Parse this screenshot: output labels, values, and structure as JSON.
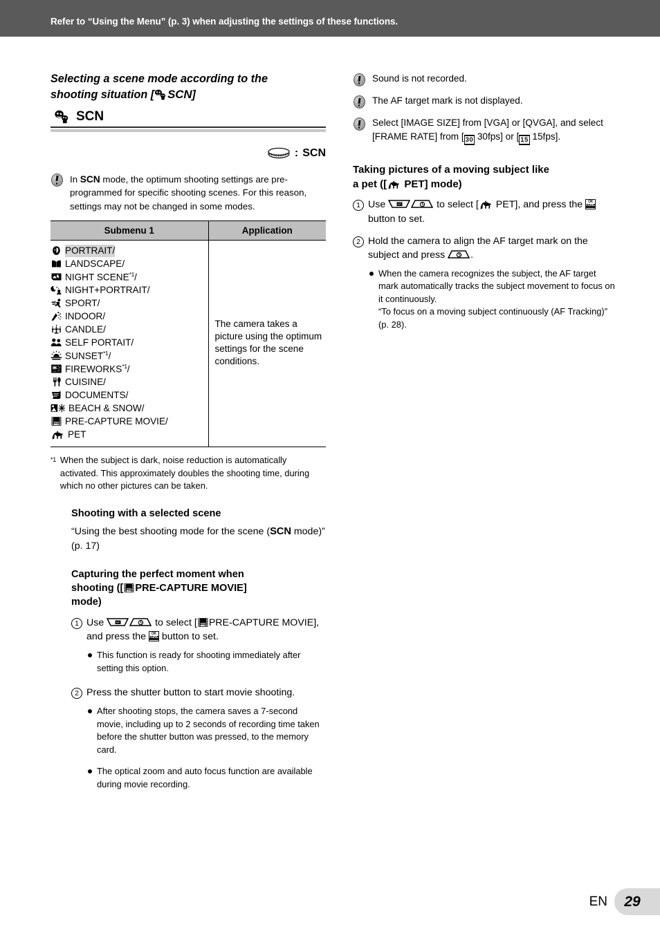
{
  "banner": {
    "text": "Refer to “Using the Menu” (p. 3) when adjusting the settings of these functions."
  },
  "left": {
    "section_title_line1": "Selecting a scene mode according to the",
    "section_title_line2_pre": "shooting situation [",
    "section_title_scn": "SCN",
    "section_title_line2_post": "]",
    "mode_label": "SCN",
    "dial_separator": ":",
    "dial_mode": "SCN",
    "intro_note": {
      "pre": "In ",
      "scn": "SCN",
      "post": " mode, the optimum shooting settings are pre-programmed for specific shooting scenes. For this reason, settings may not be changed in some modes."
    },
    "table": {
      "headers": [
        "Submenu 1",
        "Application"
      ],
      "application_text": "The camera takes a picture using the optimum settings for the scene conditions.",
      "rows": [
        {
          "icon": "portrait-icon",
          "label": "PORTRAIT/",
          "highlight": true,
          "footnote": ""
        },
        {
          "icon": "landscape-icon",
          "label": "LANDSCAPE/",
          "highlight": false,
          "footnote": ""
        },
        {
          "icon": "night-scene-icon",
          "label": "NIGHT SCENE",
          "highlight": false,
          "footnote": "*1",
          "suffix": "/"
        },
        {
          "icon": "night-portrait-icon",
          "label": "NIGHT+PORTRAIT/",
          "highlight": false,
          "footnote": ""
        },
        {
          "icon": "sport-icon",
          "label": "SPORT/",
          "highlight": false,
          "footnote": ""
        },
        {
          "icon": "indoor-icon",
          "label": "INDOOR/",
          "highlight": false,
          "footnote": ""
        },
        {
          "icon": "candle-icon",
          "label": "CANDLE/",
          "highlight": false,
          "footnote": ""
        },
        {
          "icon": "self-portrait-icon",
          "label": "SELF PORTAIT/",
          "highlight": false,
          "footnote": ""
        },
        {
          "icon": "sunset-icon",
          "label": "SUNSET",
          "highlight": false,
          "footnote": "*1",
          "suffix": "/"
        },
        {
          "icon": "fireworks-icon",
          "label": "FIREWORKS",
          "highlight": false,
          "footnote": "*1",
          "suffix": "/"
        },
        {
          "icon": "cuisine-icon",
          "label": "CUISINE/",
          "highlight": false,
          "footnote": ""
        },
        {
          "icon": "documents-icon",
          "label": "DOCUMENTS/",
          "highlight": false,
          "footnote": ""
        },
        {
          "icon": "beach-snow-icon",
          "label": "BEACH & SNOW/",
          "highlight": false,
          "footnote": ""
        },
        {
          "icon": "pre-capture-movie-icon",
          "label": "PRE-CAPTURE MOVIE/",
          "highlight": false,
          "footnote": ""
        },
        {
          "icon": "pet-icon",
          "label": "PET",
          "highlight": false,
          "footnote": ""
        }
      ]
    },
    "footnote": {
      "mark": "*1",
      "text": "When the subject is dark, noise reduction is automatically activated. This approximately doubles the shooting time, during which no other pictures can be taken."
    },
    "sub1": {
      "heading": "Shooting with a selected scene",
      "body_pre": "“Using the best shooting mode for the scene (",
      "body_scn": "SCN",
      "body_post": " mode)” (p. 17)"
    },
    "sub2": {
      "heading_line1": "Capturing the perfect moment when",
      "heading_line2_pre": "shooting ([",
      "heading_line2_post": "PRE-CAPTURE MOVIE]",
      "heading_line3": "mode)",
      "step1_pre": "Use ",
      "step1_mid": " to select [",
      "step1_post": "PRE-CAPTURE MOVIE], and press the ",
      "step1_end": " button to set.",
      "step1_num": "1",
      "step1_note": "This function is ready for shooting immediately after setting this option.",
      "step2_num": "2",
      "step2_text": "Press the shutter button to start movie shooting.",
      "step2_note1": "After shooting stops, the camera saves a 7-second movie, including up to 2 seconds of recording time taken before the shutter button was pressed, to the memory card.",
      "step2_note2": "The optical zoom and auto focus function are available during movie recording."
    }
  },
  "right": {
    "notes": [
      {
        "text": "Sound is not recorded."
      },
      {
        "text": "The AF target mark is not displayed."
      }
    ],
    "note3": {
      "part1": "Select [IMAGE SIZE] from [VGA] or [QVGA], and select [FRAME RATE] from [",
      "chip30": "30",
      "part2": " 30fps] or [",
      "chip15": "15",
      "part3": " 15fps]."
    },
    "pet_section": {
      "heading_line1": "Taking pictures of a moving subject like",
      "heading_line2_pre": "a pet ([",
      "heading_line2_post": " PET] mode)",
      "step1_num": "1",
      "step1_pre": "Use ",
      "step1_mid": " to select [",
      "step1_post": " PET], and press the ",
      "step1_end": " button to set.",
      "step2_num": "2",
      "step2_pre": "Hold the camera to align the AF target mark on the subject and press ",
      "step2_post": ".",
      "step2_note_line1": "When the camera recognizes the subject, the AF target mark automatically tracks the subject movement to focus on it continuously.",
      "step2_note_line2": "“To focus on a moving subject continuously (AF Tracking)” (p. 28)."
    }
  },
  "footer": {
    "lang": "EN",
    "page": "29"
  },
  "colors": {
    "banner_bg": "#5a5a5a",
    "table_header_bg": "#bfbfbf",
    "highlight": "#d4d4d4",
    "page_chip_bg": "#d9d9d9"
  }
}
